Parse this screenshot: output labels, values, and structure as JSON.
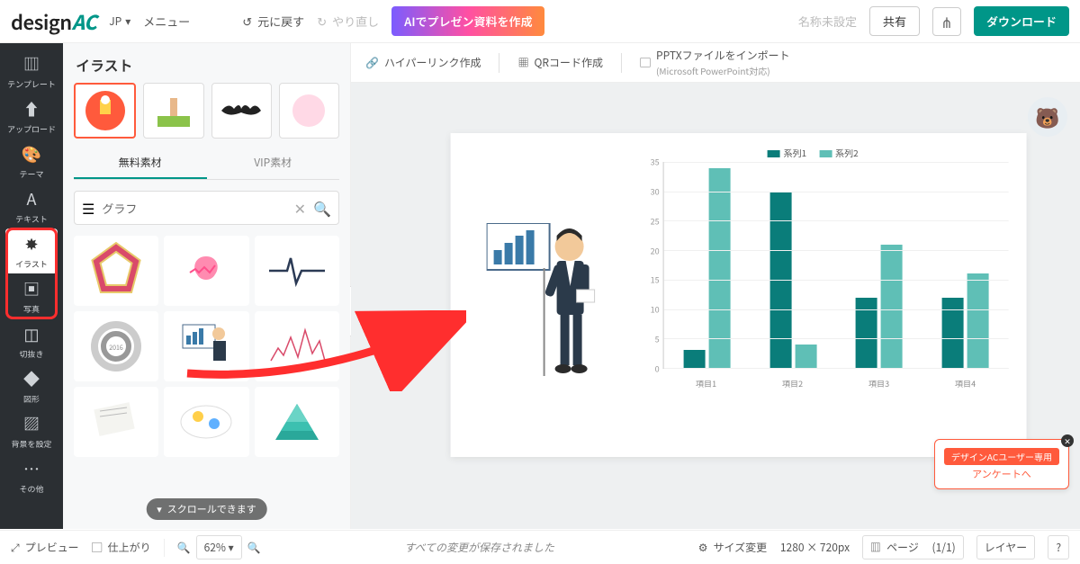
{
  "logo": {
    "text": "design",
    "suffix": "AC"
  },
  "lang": "JP",
  "topbar": {
    "menu": "メニュー",
    "undo": "元に戻す",
    "redo": "やり直し",
    "ai_create": "AIでプレゼン資料を作成",
    "title_placeholder": "名称未設定",
    "share": "共有",
    "download": "ダウンロード"
  },
  "rail": [
    {
      "label": "テンプレート"
    },
    {
      "label": "アップロード"
    },
    {
      "label": "テーマ"
    },
    {
      "label": "テキスト"
    },
    {
      "label": "イラスト"
    },
    {
      "label": "写真"
    },
    {
      "label": "切抜き"
    },
    {
      "label": "図形"
    },
    {
      "label": "背景を設定"
    },
    {
      "label": "その他"
    }
  ],
  "panel": {
    "heading": "イラスト",
    "tab_free": "無料素材",
    "tab_vip": "VIP素材",
    "search_value": "グラフ",
    "scroll_hint": "スクロールできます"
  },
  "canvas_toolbar": {
    "hyperlink": "ハイパーリンク作成",
    "qr": "QRコード作成",
    "pptx_line1": "PPTXファイルをインポート",
    "pptx_line2": "(Microsoft PowerPoint対応)"
  },
  "chart_data": {
    "type": "bar",
    "categories": [
      "項目1",
      "項目2",
      "項目3",
      "項目4"
    ],
    "series": [
      {
        "name": "系列1",
        "values": [
          3,
          30,
          12,
          12
        ],
        "color": "#0a7d7a"
      },
      {
        "name": "系列2",
        "values": [
          34,
          4,
          21,
          16
        ],
        "color": "#5fbfb6"
      }
    ],
    "ylim": [
      0,
      35
    ],
    "yticks": [
      0,
      5,
      10,
      15,
      20,
      25,
      30,
      35
    ]
  },
  "survey": {
    "tag": "デザインACユーザー専用",
    "link": "アンケートへ"
  },
  "footer": {
    "preview": "プレビュー",
    "finish": "仕上がり",
    "zoom": "62%",
    "saved": "すべての変更が保存されました",
    "resize": "サイズ変更",
    "dims": "1280 × 720px",
    "page": "ページ",
    "page_num": "(1/1)",
    "layer": "レイヤー"
  }
}
